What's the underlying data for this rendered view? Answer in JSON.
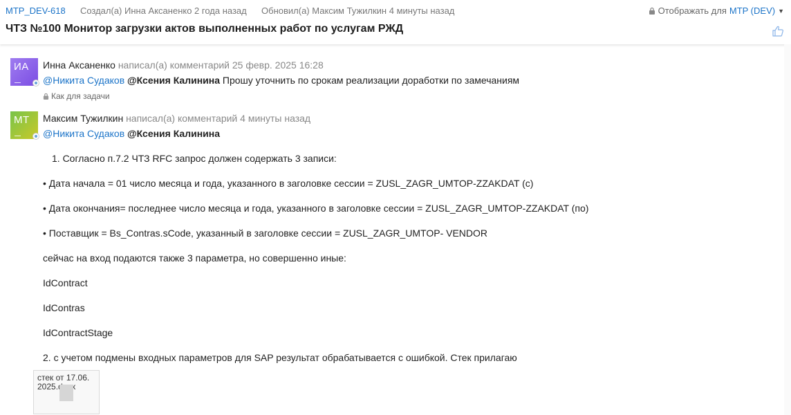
{
  "header": {
    "issue_key": "MTP_DEV-618",
    "created": "Создал(а) Инна Аксаненко 2 года назад",
    "updated": "Обновил(а) Максим Тужилкин 4 минуты назад",
    "visibility_label": "Отображать для",
    "visibility_project": "MTP (DEV)",
    "title": "ЧТЗ №100 Монитор загрузки актов выполненных работ по услугам РЖД"
  },
  "comments": [
    {
      "avatar_initials": "ИА",
      "author": "Инна Аксаненко",
      "action": "написал(а) комментарий 25 февр. 2025 16:28",
      "mention1": "@Никита Судаков",
      "mention2": "@Ксения Калинина",
      "text": "Прошу уточнить по срокам реализации доработки по замечаниям",
      "restriction": "Как для задачи"
    },
    {
      "avatar_initials": "МТ",
      "author": "Максим Тужилкин",
      "action": "написал(а) комментарий 4 минуты назад",
      "mention1": "@Никита Судаков",
      "mention2": "@Ксения Калинина",
      "lines": [
        "1. Согласно п.7.2 ЧТЗ RFC запрос должен содержать 3 записи:",
        "• Дата начала = 01 число месяца и года, указанного в заголовке сессии = ZUSL_ZAGR_UMTOP-ZZAKDAT (с)",
        "• Дата окончания= последнее число месяца и года, указанного в заголовке сессии = ZUSL_ZAGR_UMTOP-ZZAKDAT (по)",
        "• Поставщик = Bs_Contras.sCode, указанный в заголовке сессии = ZUSL_ZAGR_UMTOP- VENDOR",
        "сейчас на вход подаются также 3 параметра, но совершенно иные:",
        "IdContract",
        "IdContras",
        "IdContractStage",
        "2. с учетом подмены входных параметров для SAP результат обрабатывается с ошибкой. Стек прилагаю"
      ],
      "attachment": {
        "name_line1": "стек от 17.06.",
        "name_line2": "2025.docx"
      }
    }
  ],
  "icons": [
    "lock-icon",
    "thumbs-up-icon",
    "chevron-down-icon",
    "avatar-badge-icon",
    "file-thumbnail-icon"
  ],
  "colors": {
    "link": "#1a73c8",
    "avatar_ia": "#8b5cf0",
    "avatar_mt": "#9ec53a"
  }
}
